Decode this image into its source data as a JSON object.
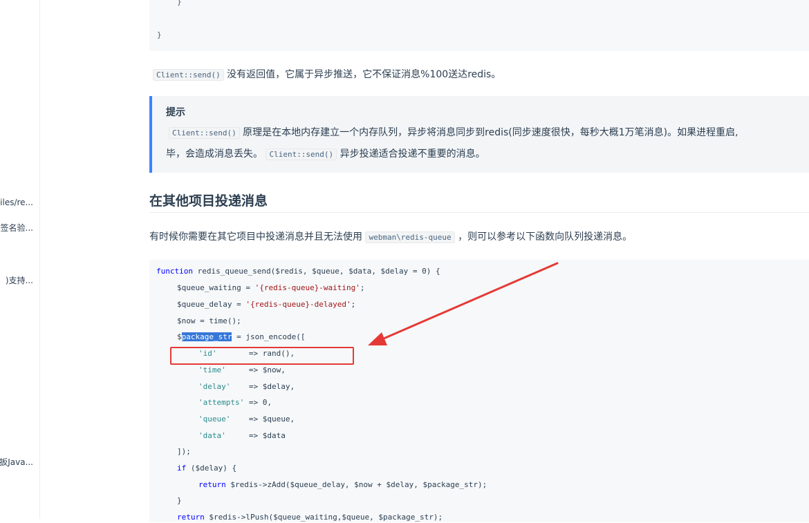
{
  "sidebar": {
    "items": [
      {
        "label": "iles/re..."
      },
      {
        "label": "签名验..."
      },
      {
        "label": ")支持..."
      },
      {
        "label": "扳Java..."
      }
    ]
  },
  "code_top": {
    "line1": "}",
    "line2": "}"
  },
  "note": {
    "code": "Client::send()",
    "text": "没有返回值，它属于异步推送，它不保证消息%100送达redis。"
  },
  "tip": {
    "title": "提示",
    "code1": "Client::send()",
    "text1": "原理是在本地内存建立一个内存队列，异步将消息同步到redis(同步速度很快，每秒大概1万笔消息)。如果进程重启,",
    "text2a": "毕，会造成消息丢失。",
    "code2": "Client::send()",
    "text2b": "异步投递适合投递不重要的消息。"
  },
  "section": {
    "heading": "在其他项目投递消息",
    "text_a": "有时候你需要在其它项目中投递消息并且无法使用",
    "code": "webman\\redis-queue",
    "text_b": "，则可以参考以下函数向队列投递消息。"
  },
  "code": {
    "l1_kw": "function",
    "l1_rest": " redis_queue_send($redis, $queue, $data, $delay = 0) {",
    "l2_a": "$queue_waiting = ",
    "l2_s": "'{redis-queue}-waiting'",
    "l2_b": ";",
    "l3_a": "$queue_delay = ",
    "l3_s": "'{redis-queue}-delayed'",
    "l3_b": ";",
    "l4": "$now = time();",
    "l5_a": "$",
    "l5_sel": "package_str",
    "l5_b": " = json_encode([",
    "l6_k": "'id'",
    "l6_v": "       => rand(),",
    "l7_k": "'time'",
    "l7_v": "     => $now,",
    "l8_k": "'delay'",
    "l8_v": "    => $delay,",
    "l9_k": "'attempts'",
    "l9_v": " => 0,",
    "l10_k": "'queue'",
    "l10_v": "    => $queue,",
    "l11_k": "'data'",
    "l11_v": "     => $data",
    "l12": "]);",
    "l13_kw": "if",
    "l13_rest": " ($delay) {",
    "l14_kw": "return",
    "l14_rest": " $redis->zAdd($queue_delay, $now + $delay, $package_str);",
    "l15": "}",
    "l16_kw": "return",
    "l16_rest": " $redis->lPush($queue_waiting,$queue, $package_str);"
  },
  "colors": {
    "accent": "#3884ff",
    "annotation": "#e53935",
    "selection": "#3477d8"
  }
}
